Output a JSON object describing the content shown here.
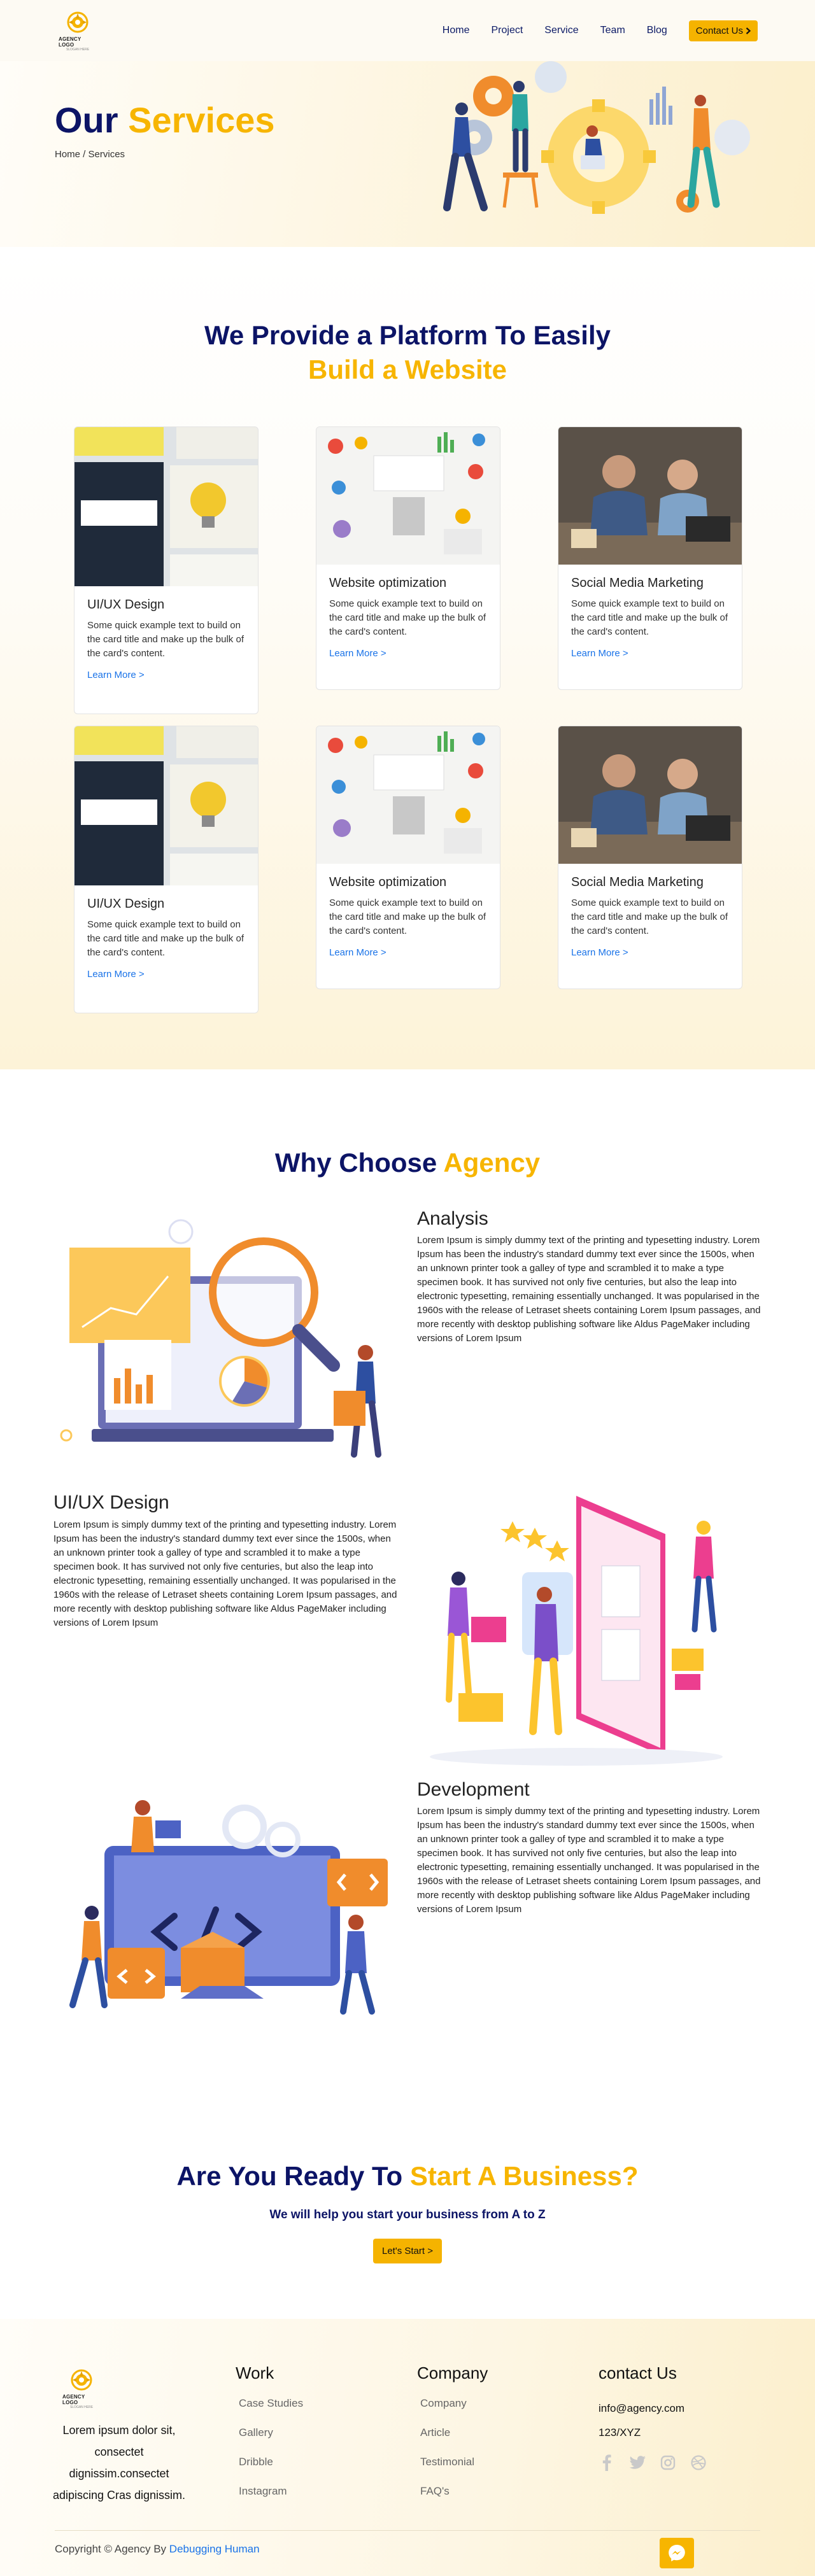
{
  "nav": {
    "logo_text": "AGENCY LOGO",
    "logo_tagline": "SLOGAN HERE",
    "links": [
      "Home",
      "Project",
      "Service",
      "Team",
      "Blog"
    ],
    "cta_label": "Contact Us",
    "cta_icon": "chevron-right-icon"
  },
  "hero": {
    "title_main": "Our",
    "title_accent": "Services",
    "breadcrumb": "Home / Services"
  },
  "services": {
    "heading_line1": "We Provide a Platform To Easily",
    "heading_line2": "Build a Website",
    "cards": [
      {
        "title": "UI/UX Design",
        "text": "Some quick example text to build on the card title and make up the bulk of the card's content.",
        "link": "Learn More >"
      },
      {
        "title": "Website optimization",
        "text": "Some quick example text to build on the card title and make up the bulk of the card's content.",
        "link": "Learn More >"
      },
      {
        "title": "Social Media Marketing",
        "text": "Some quick example text to build on the card title and make up the bulk of the card's content.",
        "link": "Learn More >"
      },
      {
        "title": "UI/UX Design",
        "text": "Some quick example text to build on the card title and make up the bulk of the card's content.",
        "link": "Learn More >"
      },
      {
        "title": "Website optimization",
        "text": "Some quick example text to build on the card title and make up the bulk of the card's content.",
        "link": "Learn More >"
      },
      {
        "title": "Social Media Marketing",
        "text": "Some quick example text to build on the card title and make up the bulk of the card's content.",
        "link": "Learn More >"
      }
    ]
  },
  "why": {
    "heading_main": "Why Choose",
    "heading_accent": "Agency",
    "features": [
      {
        "title": "Analysis",
        "text": "Lorem Ipsum is simply dummy text of the printing and typesetting industry. Lorem Ipsum has been the industry's standard dummy text ever since the 1500s, when an unknown printer took a galley of type and scrambled it to make a type specimen book. It has survived not only five centuries, but also the leap into electronic typesetting, remaining essentially unchanged. It was popularised in the 1960s with the release of Letraset sheets containing Lorem Ipsum passages, and more recently with desktop publishing software like Aldus PageMaker including versions of Lorem Ipsum"
      },
      {
        "title": "UI/UX Design",
        "text": "Lorem Ipsum is simply dummy text of the printing and typesetting industry. Lorem Ipsum has been the industry's standard dummy text ever since the 1500s, when an unknown printer took a galley of type and scrambled it to make a type specimen book. It has survived not only five centuries, but also the leap into electronic typesetting, remaining essentially unchanged. It was popularised in the 1960s with the release of Letraset sheets containing Lorem Ipsum passages, and more recently with desktop publishing software like Aldus PageMaker including versions of Lorem Ipsum"
      },
      {
        "title": "Development",
        "text": "Lorem Ipsum is simply dummy text of the printing and typesetting industry. Lorem Ipsum has been the industry's standard dummy text ever since the 1500s, when an unknown printer took a galley of type and scrambled it to make a type specimen book. It has survived not only five centuries, but also the leap into electronic typesetting, remaining essentially unchanged. It was popularised in the 1960s with the release of Letraset sheets containing Lorem Ipsum passages, and more recently with desktop publishing software like Aldus PageMaker including versions of Lorem Ipsum"
      }
    ]
  },
  "cta": {
    "heading_main": "Are You Ready To",
    "heading_accent": "Start A Business?",
    "subtitle": "We will help you start your business from A to Z",
    "button": "Let's Start >"
  },
  "footer": {
    "about": "Lorem ipsum dolor sit, consectet dignissim.consectet adipiscing Cras dignissim.",
    "work_title": "Work",
    "work_links": [
      "Case Studies",
      "Gallery",
      "Dribble",
      "Instagram"
    ],
    "company_title": "Company",
    "company_links": [
      "Company",
      "Article",
      "Testimonial",
      "FAQ's"
    ],
    "contact_title": "contact Us",
    "email": "info@agency.com",
    "address": "123/XYZ",
    "socials": [
      "facebook-icon",
      "twitter-icon",
      "instagram-icon",
      "dribbble-icon"
    ],
    "copyright_prefix": "Copyright © Agency By",
    "copyright_brand": "Debugging Human",
    "chat_icon": "messenger-icon"
  },
  "colors": {
    "navy": "#0c1466",
    "accent": "#f7b500",
    "link": "#1a73e8"
  }
}
